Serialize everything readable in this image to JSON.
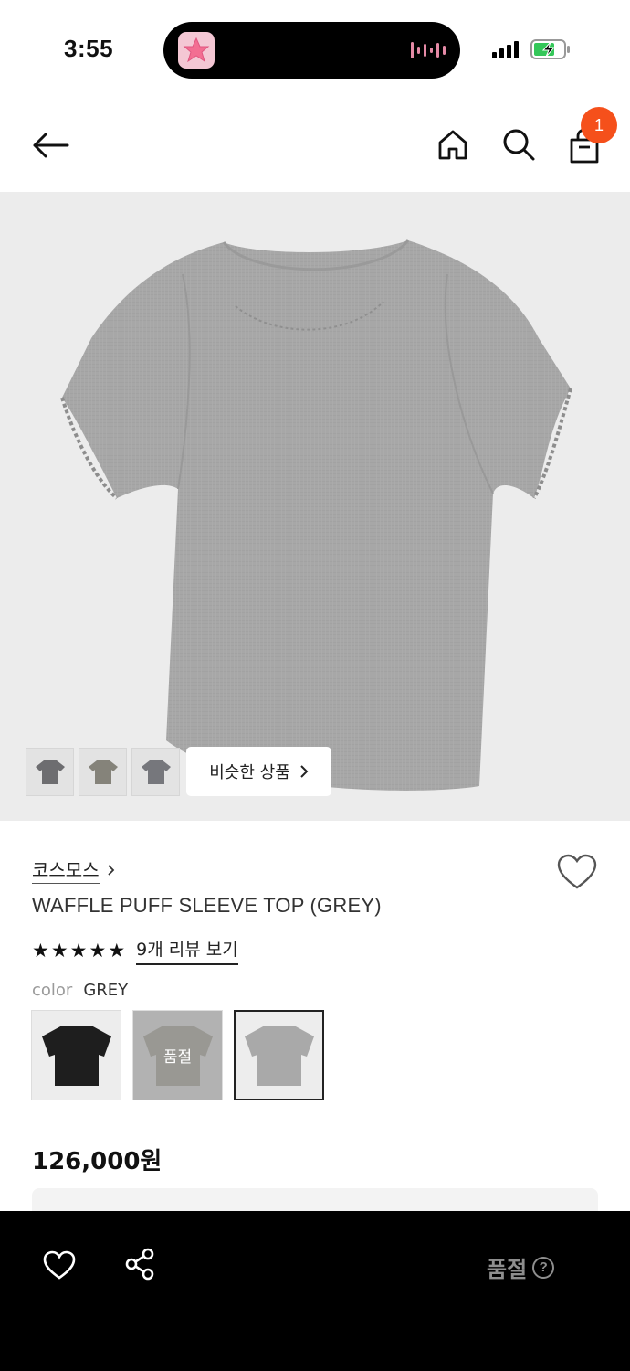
{
  "status": {
    "time": "3:55"
  },
  "header": {
    "cart_count": "1"
  },
  "hero": {
    "similar_button_label": "비슷한 상품",
    "thumbnails": [
      "t-shirt-charcoal",
      "t-shirt-khaki",
      "t-shirt-grey"
    ]
  },
  "product": {
    "brand": "코스모스",
    "name": "WAFFLE PUFF SLEEVE TOP (GREY)",
    "rating": 5,
    "review_link": "9개 리뷰 보기",
    "color_label": "color",
    "color_value": "GREY",
    "swatches": [
      {
        "color": "#1e1e1e",
        "sold_out_label": ""
      },
      {
        "color": "#b6b3a8",
        "sold_out_label": "품절"
      },
      {
        "color": "#a9a9a9",
        "sold_out_label": ""
      }
    ],
    "price": "126,000원"
  },
  "bottom_bar": {
    "status_label": "품절",
    "help_glyph": "?"
  },
  "colors": {
    "badge": "#f5501b",
    "hero_bg": "#ececec",
    "bottom_bar": "#000000"
  }
}
